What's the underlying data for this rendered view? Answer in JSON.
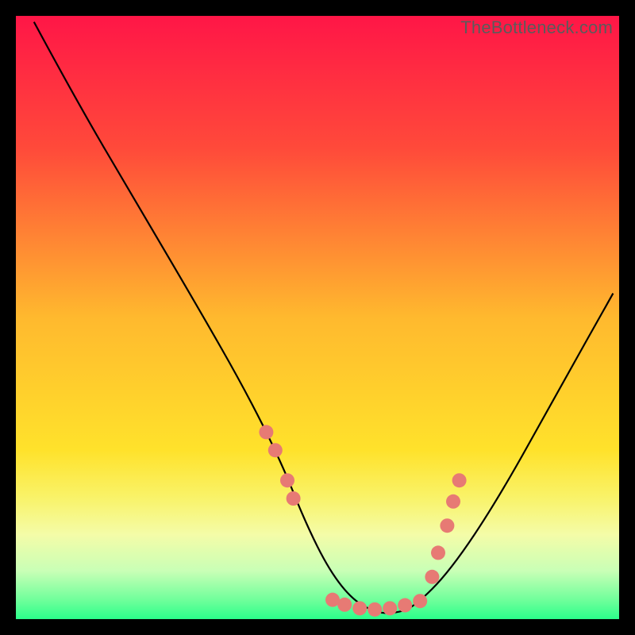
{
  "watermark": "TheBottleneck.com",
  "chart_data": {
    "type": "line",
    "title": "",
    "xlabel": "",
    "ylabel": "",
    "xlim": [
      0,
      100
    ],
    "ylim": [
      0,
      100
    ],
    "background_gradient_stops": [
      {
        "pct": 0,
        "color": "#ff1647"
      },
      {
        "pct": 22,
        "color": "#ff4a3a"
      },
      {
        "pct": 50,
        "color": "#ffb92e"
      },
      {
        "pct": 72,
        "color": "#ffe22b"
      },
      {
        "pct": 80,
        "color": "#f9f36a"
      },
      {
        "pct": 86,
        "color": "#f4fca8"
      },
      {
        "pct": 92,
        "color": "#c9ffb6"
      },
      {
        "pct": 97,
        "color": "#6cff9a"
      },
      {
        "pct": 100,
        "color": "#2bff8a"
      }
    ],
    "series": [
      {
        "name": "bottleneck-curve",
        "x": [
          3,
          10,
          20,
          30,
          38,
          44,
          48,
          52,
          56,
          60,
          63,
          66,
          72,
          80,
          90,
          99
        ],
        "y": [
          99,
          86,
          69,
          52,
          38,
          26,
          16,
          8,
          3,
          1,
          1,
          2,
          8,
          20,
          38,
          54
        ]
      }
    ],
    "markers": {
      "name": "highlight-dots",
      "color": "#e77a74",
      "radius": 9,
      "points": [
        {
          "x": 41.5,
          "y": 31
        },
        {
          "x": 43.0,
          "y": 28
        },
        {
          "x": 45.0,
          "y": 23
        },
        {
          "x": 46.0,
          "y": 20
        },
        {
          "x": 52.5,
          "y": 3.2
        },
        {
          "x": 54.5,
          "y": 2.4
        },
        {
          "x": 57.0,
          "y": 1.8
        },
        {
          "x": 59.5,
          "y": 1.6
        },
        {
          "x": 62.0,
          "y": 1.8
        },
        {
          "x": 64.5,
          "y": 2.3
        },
        {
          "x": 67.0,
          "y": 3.0
        },
        {
          "x": 69.0,
          "y": 7.0
        },
        {
          "x": 70.0,
          "y": 11.0
        },
        {
          "x": 71.5,
          "y": 15.5
        },
        {
          "x": 72.5,
          "y": 19.5
        },
        {
          "x": 73.5,
          "y": 23.0
        }
      ]
    }
  }
}
